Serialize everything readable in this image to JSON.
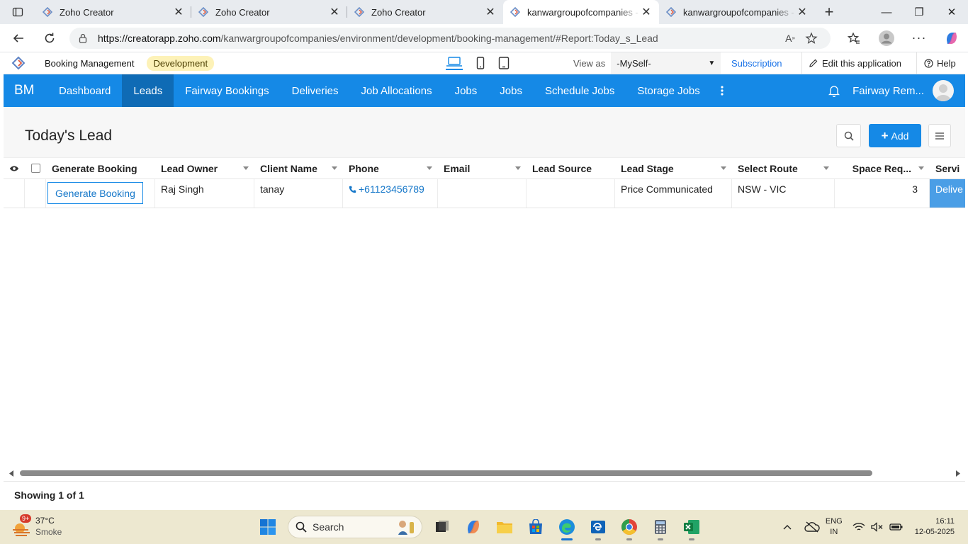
{
  "browser": {
    "tabs": [
      {
        "title": "Zoho Creator",
        "active": false
      },
      {
        "title": "Zoho Creator",
        "active": false
      },
      {
        "title": "Zoho Creator",
        "active": false
      },
      {
        "title": "kanwargroupofcompanies - E",
        "active": true
      },
      {
        "title": "kanwargroupofcompanies - E",
        "active": false
      }
    ],
    "url_domain": "https://creatorapp.zoho.com",
    "url_path": "/kanwargroupofcompanies/environment/development/booking-management/#Report:Today_s_Lead"
  },
  "app_toolbar": {
    "app_name": "Booking Management",
    "environment": "Development",
    "view_as_label": "View as",
    "view_as_value": "-MySelf-",
    "subscription": "Subscription",
    "edit_app": "Edit this application",
    "help": "Help"
  },
  "nav": {
    "brand": "BM",
    "items": [
      "Dashboard",
      "Leads",
      "Fairway Bookings",
      "Deliveries",
      "Job Allocations",
      "Jobs",
      "Jobs",
      "Schedule Jobs",
      "Storage Jobs"
    ],
    "active_index": 1,
    "user": "Fairway Rem..."
  },
  "report": {
    "title": "Today's Lead",
    "add_label": "Add",
    "columns": [
      "Generate Booking",
      "Lead Owner",
      "Client Name",
      "Phone",
      "Email",
      "Lead Source",
      "Lead Stage",
      "Select Route",
      "Space Req...",
      "Servi"
    ],
    "rows": [
      {
        "generate_booking": "Generate Booking",
        "lead_owner": "Raj Singh",
        "client_name": "tanay",
        "phone": "+61123456789",
        "email": "",
        "lead_source": "",
        "lead_stage": "Price Communicated",
        "select_route": "NSW - VIC",
        "space_req": "3",
        "service": "Delive"
      }
    ],
    "footer": "Showing 1 of 1"
  },
  "taskbar": {
    "temperature": "37°C",
    "condition": "Smoke",
    "weather_badge": "9+",
    "search": "Search",
    "lang1": "ENG",
    "lang2": "IN",
    "time": "16:11",
    "date": "12-05-2025"
  },
  "colors": {
    "nav_bg": "#1589e6",
    "nav_active": "#0f6bb5",
    "link": "#1577c9",
    "env_badge": "#fdf2b8"
  }
}
